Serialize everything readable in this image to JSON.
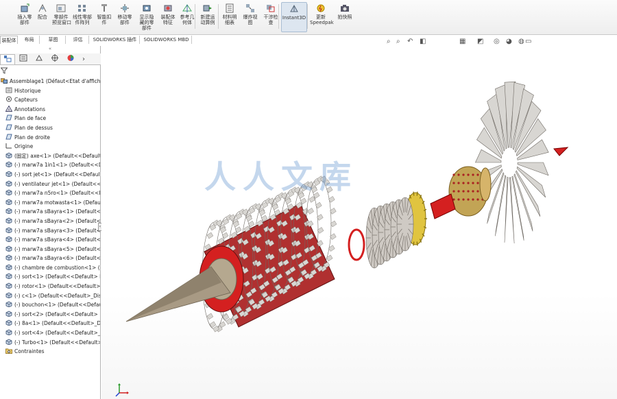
{
  "ribbon": {
    "items": [
      {
        "label": "插入零\n部件",
        "icon": "insert-component-icon"
      },
      {
        "label": "配合",
        "icon": "mate-icon"
      },
      {
        "label": "零部件\n预览窗口",
        "icon": "component-preview-icon"
      },
      {
        "label": "线性零部\n件阵列",
        "icon": "linear-pattern-icon"
      },
      {
        "label": "智能扣\n件",
        "icon": "smart-fastener-icon"
      },
      {
        "label": "移动零\n部件",
        "icon": "move-component-icon"
      },
      {
        "label": "显示隐\n藏的零\n部件",
        "icon": "show-hidden-icon"
      },
      {
        "label": "装配体\n特征",
        "icon": "assembly-feature-icon"
      },
      {
        "label": "参考几\n何体",
        "icon": "reference-geometry-icon"
      },
      {
        "label": "新建运\n动算例",
        "icon": "motion-study-icon"
      },
      {
        "label": "材料明\n细表",
        "icon": "bom-icon"
      },
      {
        "label": "爆炸视\n图",
        "icon": "exploded-view-icon"
      },
      {
        "label": "干涉检\n查",
        "icon": "interference-check-icon"
      },
      {
        "label": "Instant3D",
        "icon": "instant3d-icon"
      },
      {
        "label": "更新\nSpeedpak",
        "icon": "speedpak-icon"
      },
      {
        "label": "拍快照",
        "icon": "snapshot-icon"
      }
    ]
  },
  "tabs": [
    {
      "label": "装配体"
    },
    {
      "label": "布局"
    },
    {
      "label": "草图"
    },
    {
      "label": "评估"
    },
    {
      "label": "SOLIDWORKS 插件"
    },
    {
      "label": "SOLIDWORKS MBD"
    }
  ],
  "hud_icons": [
    "zoom-to-fit-icon",
    "zoom-area-icon",
    "previous-view-icon",
    "section-view-icon",
    "view-orientation-icon",
    "display-style-icon",
    "hide-show-icon",
    "edit-appearance-icon",
    "scene-icon",
    "view-settings-icon"
  ],
  "panel": {
    "collapse_glyph": "«",
    "tree": [
      {
        "text": "Assemblage1  (Défaut<Etat d'affichag",
        "icon": "assembly-icon"
      },
      {
        "text": "Historique",
        "icon": "history-icon"
      },
      {
        "text": "Capteurs",
        "icon": "sensors-icon"
      },
      {
        "text": "Annotations",
        "icon": "annotations-icon"
      },
      {
        "text": "Plan de face",
        "icon": "plane-icon"
      },
      {
        "text": "Plan de dessus",
        "icon": "plane-icon"
      },
      {
        "text": "Plan de droite",
        "icon": "plane-icon"
      },
      {
        "text": "Origine",
        "icon": "origin-icon"
      },
      {
        "text": "(固定) axe<1> (Default<<Default>",
        "icon": "part-icon"
      },
      {
        "text": "(-) marw7a 1in1<1> (Default<<Def",
        "icon": "part-icon"
      },
      {
        "text": "(-) sort jet<1> (Default<<Default>",
        "icon": "part-icon"
      },
      {
        "text": "(-) ventilateur jet<1> (Default<<De",
        "icon": "part-icon"
      },
      {
        "text": "(-) marw7a n5ro<1> (Default<<D",
        "icon": "part-icon"
      },
      {
        "text": "(-) marw7a motwasta<1> (Default",
        "icon": "part-icon"
      },
      {
        "text": "(-) marw7a sBayra<1> (Default<<",
        "icon": "part-icon"
      },
      {
        "text": "(-) marw7a sBayra<2> (Default<<",
        "icon": "part-icon"
      },
      {
        "text": "(-) marw7a sBayra<3> (Default<<",
        "icon": "part-icon"
      },
      {
        "text": "(-) marw7a sBayra<4> (Default<<",
        "icon": "part-icon"
      },
      {
        "text": "(-) marw7a sBayra<5> (Default<<",
        "icon": "part-icon"
      },
      {
        "text": "(-) marw7a sBayra<6> (Default<<",
        "icon": "part-icon"
      },
      {
        "text": "(-) chambre de combustion<1> (D",
        "icon": "part-icon"
      },
      {
        "text": "(-) sort<1> (Default<<Default> D",
        "icon": "part-icon"
      },
      {
        "text": "(-) rotor<1> (Default<<Default>",
        "icon": "part-icon"
      },
      {
        "text": "(-) c<1> (Default<<Default>_Disp",
        "icon": "part-icon"
      },
      {
        "text": "(-) bouchon<1> (Default<<Defaul",
        "icon": "part-icon"
      },
      {
        "text": "(-) sort<2> (Default<<Default>",
        "icon": "part-icon"
      },
      {
        "text": "(-) 8a<1> (Default<<Default>_Disp",
        "icon": "part-icon"
      },
      {
        "text": "(-) sort<4> (Default<<Default>_D",
        "icon": "part-icon"
      },
      {
        "text": "(-) Turbo<1> (Default<<Default>",
        "icon": "part-icon"
      },
      {
        "text": "Contraintes",
        "icon": "mates-folder-icon"
      }
    ]
  },
  "watermark": "人人文库",
  "colors": {
    "blade": "#d8d6d2",
    "blade_edge": "#6f6a64",
    "red_hub": "#d42020",
    "gold": "#e0c440",
    "bronze": "#c2a455",
    "cone": "#a89a84"
  }
}
